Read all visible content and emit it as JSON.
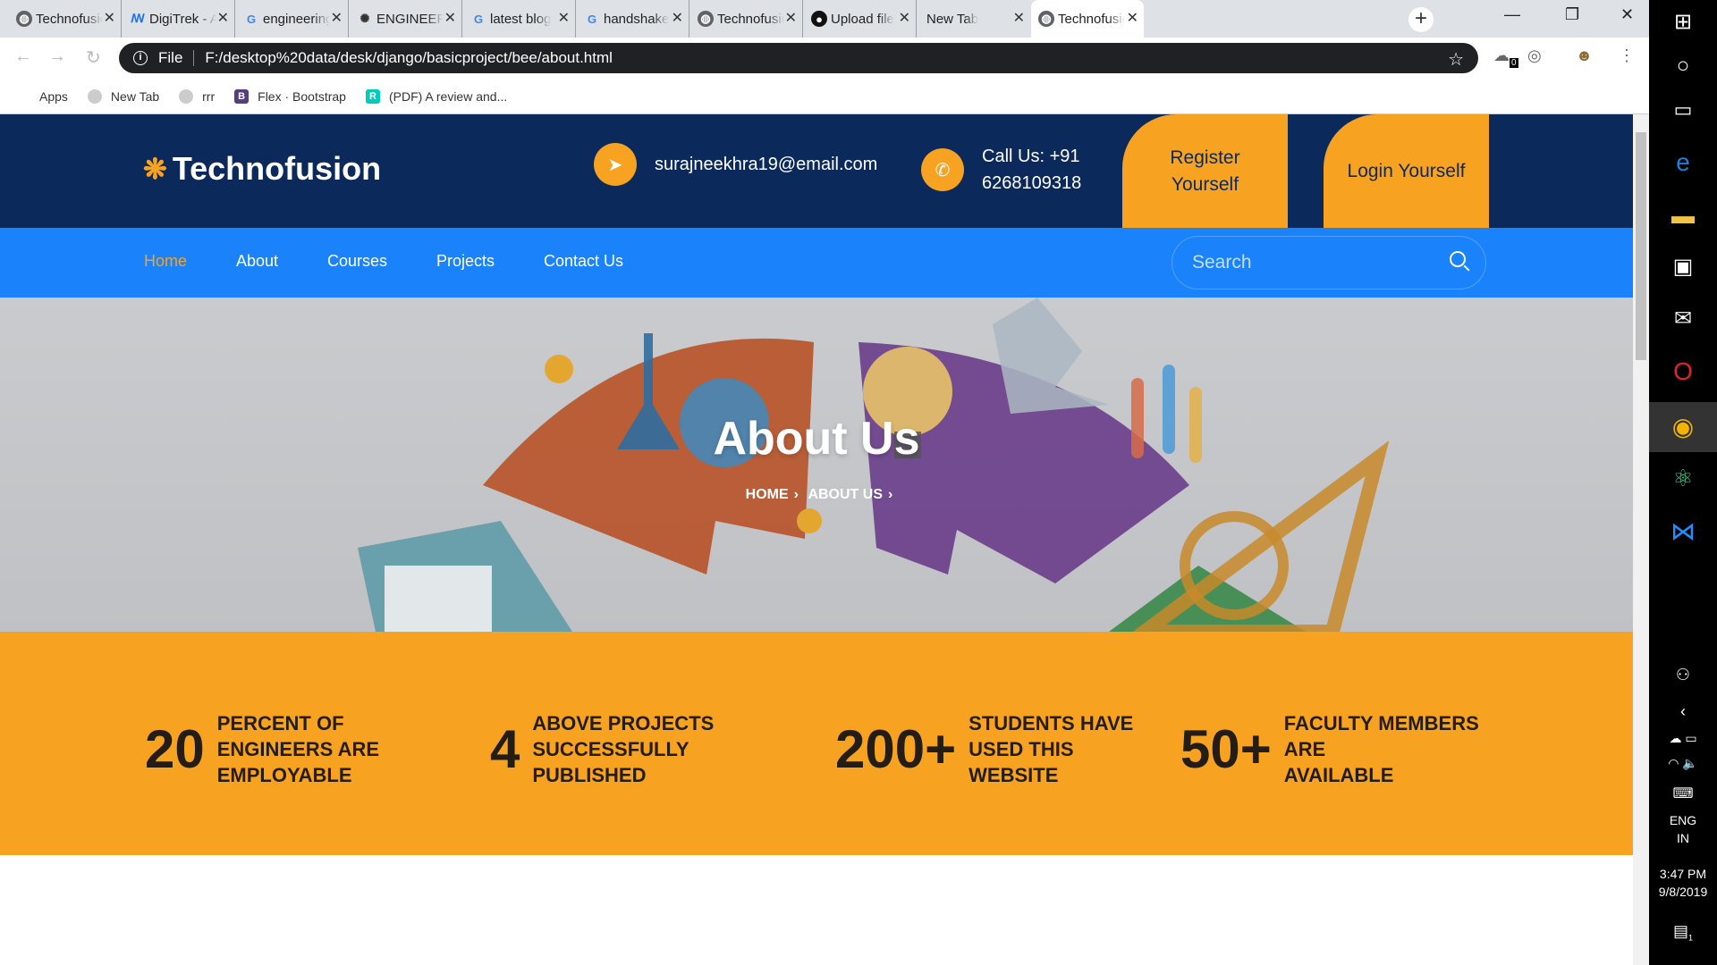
{
  "browser": {
    "tabs": [
      {
        "label": "Technofusion",
        "icon": "globe-icon"
      },
      {
        "label": "DigiTrek - A",
        "icon": "digitrek-icon"
      },
      {
        "label": "engineering",
        "icon": "google-icon"
      },
      {
        "label": "ENGINEERING",
        "icon": "openai-icon"
      },
      {
        "label": "latest blog",
        "icon": "google-icon"
      },
      {
        "label": "handshake",
        "icon": "google-icon"
      },
      {
        "label": "Technofusion",
        "icon": "globe-icon"
      },
      {
        "label": "Upload file",
        "icon": "github-icon"
      },
      {
        "label": "New Tab",
        "icon": ""
      },
      {
        "label": "Technofusion",
        "icon": "globe-icon"
      }
    ],
    "address": {
      "scheme": "File",
      "url": "F:/desktop%20data/desk/django/basicproject/bee/about.html"
    },
    "extension_badge": "0",
    "bookmarks": [
      {
        "label": "Apps",
        "icon": "apps-grid-icon"
      },
      {
        "label": "New Tab",
        "icon": "page-icon"
      },
      {
        "label": "rrr",
        "icon": "page-icon"
      },
      {
        "label": "Flex · Bootstrap",
        "icon": "bootstrap-icon"
      },
      {
        "label": "(PDF) A review and...",
        "icon": "researchgate-icon"
      }
    ]
  },
  "site": {
    "brand": "Technofusion",
    "email": "surajneekhra19@email.com",
    "phone_line1": "Call Us: +91",
    "phone_line2": "6268109318",
    "register_line1": "Register",
    "register_line2": "Yourself",
    "login": "Login Yourself",
    "nav": [
      "Home",
      "About",
      "Courses",
      "Projects",
      "Contact Us"
    ],
    "active_nav": "Home",
    "search_placeholder": "Search",
    "hero_title": "About Us",
    "breadcrumb": [
      "HOME",
      "ABOUT US"
    ],
    "stats": [
      {
        "number": "20",
        "line1": "PERCENT OF",
        "line2": "ENGINEERS ARE",
        "line3": "EMPLOYABLE"
      },
      {
        "number": "4",
        "line1": "ABOVE PROJECTS",
        "line2": "SUCCESSFULLY",
        "line3": "PUBLISHED"
      },
      {
        "number": "200+",
        "line1": "STUDENTS HAVE",
        "line2": "USED THIS",
        "line3": "WEBSITE"
      },
      {
        "number": "50+",
        "line1": "FACULTY MEMBERS",
        "line2": "ARE",
        "line3": "AVAILABLE"
      }
    ]
  },
  "taskbar": {
    "language": "ENG",
    "region": "IN",
    "time": "3:47 PM",
    "date": "9/8/2019",
    "notification_count": "1"
  },
  "colors": {
    "header_navy": "#0b2a5b",
    "nav_blue": "#1a82fb",
    "accent_orange": "#f7a321"
  }
}
